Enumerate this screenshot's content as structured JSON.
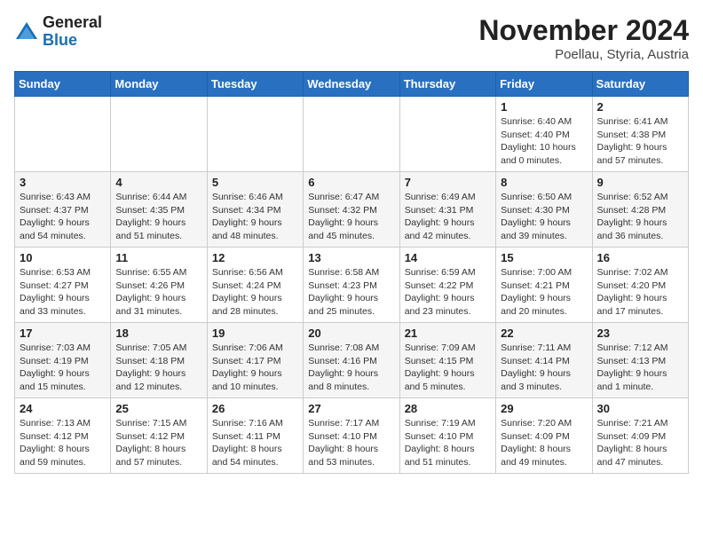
{
  "header": {
    "logo_line1": "General",
    "logo_line2": "Blue",
    "month": "November 2024",
    "location": "Poellau, Styria, Austria"
  },
  "weekdays": [
    "Sunday",
    "Monday",
    "Tuesday",
    "Wednesday",
    "Thursday",
    "Friday",
    "Saturday"
  ],
  "weeks": [
    [
      {
        "day": "",
        "info": ""
      },
      {
        "day": "",
        "info": ""
      },
      {
        "day": "",
        "info": ""
      },
      {
        "day": "",
        "info": ""
      },
      {
        "day": "",
        "info": ""
      },
      {
        "day": "1",
        "info": "Sunrise: 6:40 AM\nSunset: 4:40 PM\nDaylight: 10 hours\nand 0 minutes."
      },
      {
        "day": "2",
        "info": "Sunrise: 6:41 AM\nSunset: 4:38 PM\nDaylight: 9 hours\nand 57 minutes."
      }
    ],
    [
      {
        "day": "3",
        "info": "Sunrise: 6:43 AM\nSunset: 4:37 PM\nDaylight: 9 hours\nand 54 minutes."
      },
      {
        "day": "4",
        "info": "Sunrise: 6:44 AM\nSunset: 4:35 PM\nDaylight: 9 hours\nand 51 minutes."
      },
      {
        "day": "5",
        "info": "Sunrise: 6:46 AM\nSunset: 4:34 PM\nDaylight: 9 hours\nand 48 minutes."
      },
      {
        "day": "6",
        "info": "Sunrise: 6:47 AM\nSunset: 4:32 PM\nDaylight: 9 hours\nand 45 minutes."
      },
      {
        "day": "7",
        "info": "Sunrise: 6:49 AM\nSunset: 4:31 PM\nDaylight: 9 hours\nand 42 minutes."
      },
      {
        "day": "8",
        "info": "Sunrise: 6:50 AM\nSunset: 4:30 PM\nDaylight: 9 hours\nand 39 minutes."
      },
      {
        "day": "9",
        "info": "Sunrise: 6:52 AM\nSunset: 4:28 PM\nDaylight: 9 hours\nand 36 minutes."
      }
    ],
    [
      {
        "day": "10",
        "info": "Sunrise: 6:53 AM\nSunset: 4:27 PM\nDaylight: 9 hours\nand 33 minutes."
      },
      {
        "day": "11",
        "info": "Sunrise: 6:55 AM\nSunset: 4:26 PM\nDaylight: 9 hours\nand 31 minutes."
      },
      {
        "day": "12",
        "info": "Sunrise: 6:56 AM\nSunset: 4:24 PM\nDaylight: 9 hours\nand 28 minutes."
      },
      {
        "day": "13",
        "info": "Sunrise: 6:58 AM\nSunset: 4:23 PM\nDaylight: 9 hours\nand 25 minutes."
      },
      {
        "day": "14",
        "info": "Sunrise: 6:59 AM\nSunset: 4:22 PM\nDaylight: 9 hours\nand 23 minutes."
      },
      {
        "day": "15",
        "info": "Sunrise: 7:00 AM\nSunset: 4:21 PM\nDaylight: 9 hours\nand 20 minutes."
      },
      {
        "day": "16",
        "info": "Sunrise: 7:02 AM\nSunset: 4:20 PM\nDaylight: 9 hours\nand 17 minutes."
      }
    ],
    [
      {
        "day": "17",
        "info": "Sunrise: 7:03 AM\nSunset: 4:19 PM\nDaylight: 9 hours\nand 15 minutes."
      },
      {
        "day": "18",
        "info": "Sunrise: 7:05 AM\nSunset: 4:18 PM\nDaylight: 9 hours\nand 12 minutes."
      },
      {
        "day": "19",
        "info": "Sunrise: 7:06 AM\nSunset: 4:17 PM\nDaylight: 9 hours\nand 10 minutes."
      },
      {
        "day": "20",
        "info": "Sunrise: 7:08 AM\nSunset: 4:16 PM\nDaylight: 9 hours\nand 8 minutes."
      },
      {
        "day": "21",
        "info": "Sunrise: 7:09 AM\nSunset: 4:15 PM\nDaylight: 9 hours\nand 5 minutes."
      },
      {
        "day": "22",
        "info": "Sunrise: 7:11 AM\nSunset: 4:14 PM\nDaylight: 9 hours\nand 3 minutes."
      },
      {
        "day": "23",
        "info": "Sunrise: 7:12 AM\nSunset: 4:13 PM\nDaylight: 9 hours\nand 1 minute."
      }
    ],
    [
      {
        "day": "24",
        "info": "Sunrise: 7:13 AM\nSunset: 4:12 PM\nDaylight: 8 hours\nand 59 minutes."
      },
      {
        "day": "25",
        "info": "Sunrise: 7:15 AM\nSunset: 4:12 PM\nDaylight: 8 hours\nand 57 minutes."
      },
      {
        "day": "26",
        "info": "Sunrise: 7:16 AM\nSunset: 4:11 PM\nDaylight: 8 hours\nand 54 minutes."
      },
      {
        "day": "27",
        "info": "Sunrise: 7:17 AM\nSunset: 4:10 PM\nDaylight: 8 hours\nand 53 minutes."
      },
      {
        "day": "28",
        "info": "Sunrise: 7:19 AM\nSunset: 4:10 PM\nDaylight: 8 hours\nand 51 minutes."
      },
      {
        "day": "29",
        "info": "Sunrise: 7:20 AM\nSunset: 4:09 PM\nDaylight: 8 hours\nand 49 minutes."
      },
      {
        "day": "30",
        "info": "Sunrise: 7:21 AM\nSunset: 4:09 PM\nDaylight: 8 hours\nand 47 minutes."
      }
    ]
  ]
}
